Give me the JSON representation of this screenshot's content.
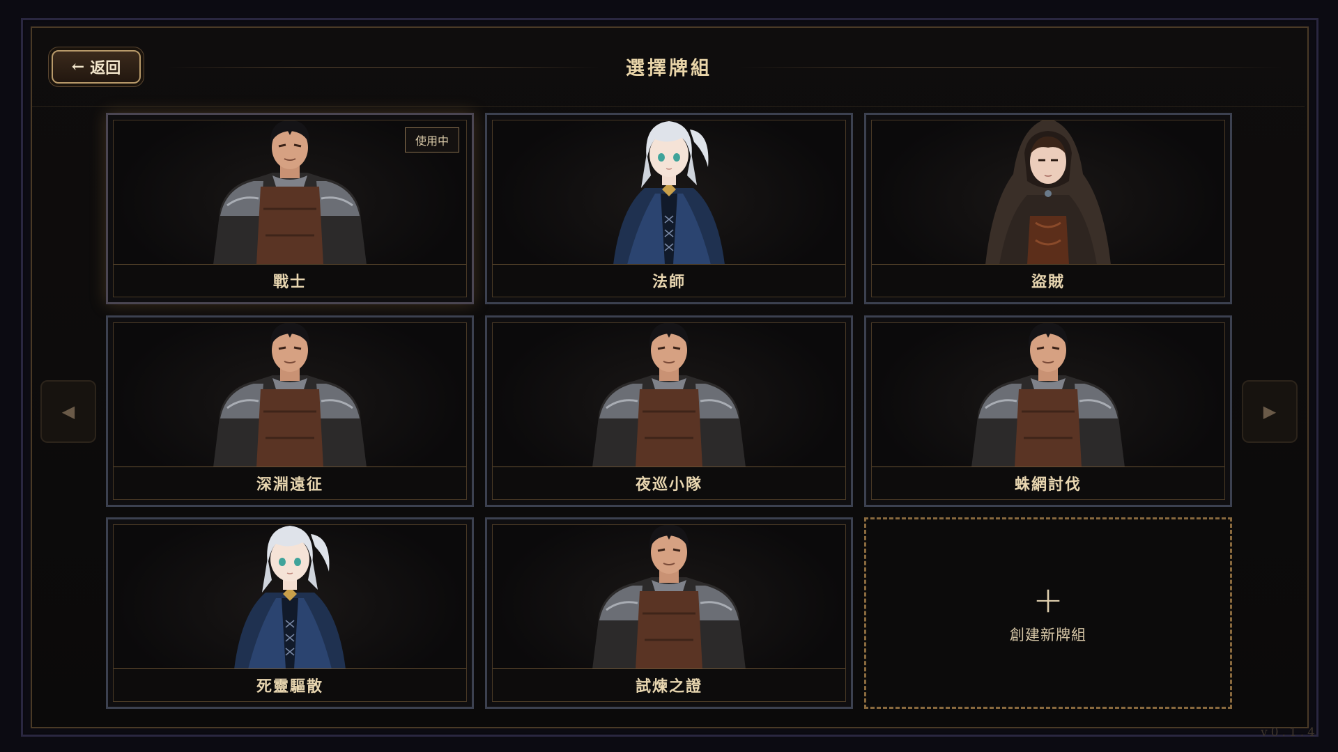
{
  "header": {
    "back_label": "返回",
    "back_arrow": "←",
    "title": "選擇牌組"
  },
  "decks": [
    {
      "name": "戰士",
      "portrait": "warrior",
      "active": true,
      "badge": "使用中"
    },
    {
      "name": "法師",
      "portrait": "mage",
      "active": false
    },
    {
      "name": "盜賊",
      "portrait": "rogue",
      "active": false
    },
    {
      "name": "深淵遠征",
      "portrait": "warrior",
      "active": false
    },
    {
      "name": "夜巡小隊",
      "portrait": "warrior",
      "active": false
    },
    {
      "name": "蛛網討伐",
      "portrait": "warrior",
      "active": false
    },
    {
      "name": "死靈驅散",
      "portrait": "mage",
      "active": false
    },
    {
      "name": "試煉之證",
      "portrait": "warrior",
      "active": false
    }
  ],
  "create": {
    "label": "創建新牌組",
    "icon": "plus-icon"
  },
  "nav": {
    "prev_icon": "◀",
    "next_icon": "▶"
  },
  "version": "v0.1.4",
  "colors": {
    "accent_gold": "#b89a6a",
    "card_border": "#3c4150",
    "label_text": "#e8d6b0"
  }
}
